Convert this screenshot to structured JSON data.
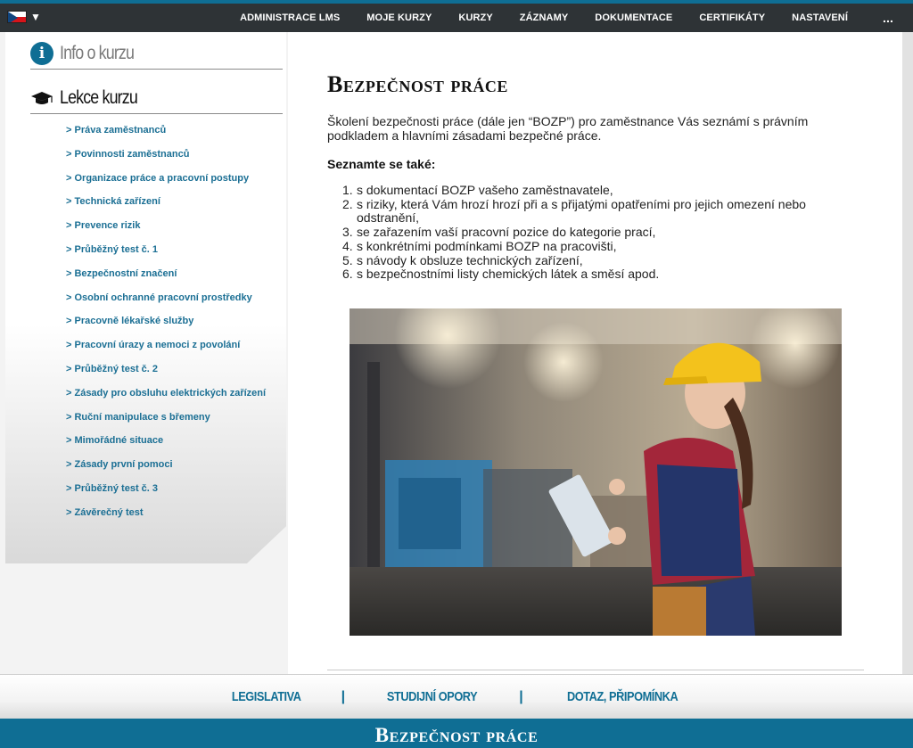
{
  "nav": {
    "items": [
      "ADMINISTRACE LMS",
      "MOJE KURZY",
      "KURZY",
      "ZÁZNAMY",
      "DOKUMENTACE",
      "CERTIFIKÁTY",
      "NASTAVENÍ"
    ],
    "more": "...",
    "language_flag": "czech-flag-icon",
    "language_caret": "▼"
  },
  "sidebar": {
    "info_title": "Info o kurzu",
    "lessons_title": "Lekce kurzu",
    "lessons": [
      "> Práva zaměstnanců",
      "> Povinnosti zaměstnanců",
      "> Organizace práce a pracovní postupy",
      "> Technická zařízení",
      "> Prevence rizik",
      "> Průběžný test č. 1",
      "> Bezpečnostní značení",
      "> Osobní ochranné pracovní prostředky",
      "> Pracovně lékařské služby",
      "> Pracovní úrazy a nemoci z povolání",
      "> Průběžný test č. 2",
      "> Zásady pro obsluhu elektrických zařízení",
      "> Ruční manipulace s břemeny",
      "> Mimořádné situace",
      "> Zásady první pomoci",
      "> Průběžný test č. 3",
      "> Závěrečný test"
    ]
  },
  "main": {
    "title": "Bezpečnost práce",
    "intro": "Školení bezpečnosti práce (dále jen “BOZP”) pro zaměstnance Vás seznámí s právním podkladem a hlavními zásadami bezpečné práce.",
    "see_also_label": "Seznamte se také:",
    "items": [
      "s dokumentací BOZP vašeho zaměstnavatele,",
      "s riziky, která Vám hrozí hrozí při a s přijatými opatřeními pro jejich omezení nebo odstranění,",
      "se zařazením vaší pracovní pozice do kategorie prací,",
      "s konkrétními podmínkami BOZP na pracovišti,",
      "s návody k obsluze technických zařízení,",
      "s bezpečnostními listy chemických látek a směsí apod."
    ],
    "photo": "worker-with-hard-hat-photo"
  },
  "footer": {
    "links": [
      "LEGISLATIVA",
      "STUDIJNÍ OPORY",
      "DOTAZ, PŘIPOMÍNKA"
    ],
    "separator": "|",
    "title": "Bezpečnost práce"
  },
  "colors": {
    "accent": "#0f6e94",
    "nav_bg": "#2e3336"
  }
}
